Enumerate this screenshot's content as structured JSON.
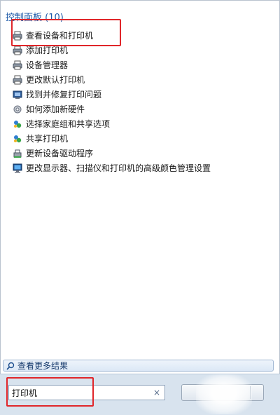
{
  "header": {
    "title": "控制面板 (10)"
  },
  "items": [
    {
      "label": "查看设备和打印机",
      "icon": "printer-icon"
    },
    {
      "label": "添加打印机",
      "icon": "printer-icon"
    },
    {
      "label": "设备管理器",
      "icon": "printer-icon"
    },
    {
      "label": "更改默认打印机",
      "icon": "printer-icon"
    },
    {
      "label": "找到并修复打印问题",
      "icon": "troubleshoot-icon"
    },
    {
      "label": "如何添加新硬件",
      "icon": "gear-icon"
    },
    {
      "label": "选择家庭组和共享选项",
      "icon": "homegroup-icon"
    },
    {
      "label": "共享打印机",
      "icon": "homegroup-icon"
    },
    {
      "label": "更新设备驱动程序",
      "icon": "device-driver-icon"
    },
    {
      "label": "更改显示器、扫描仪和打印机的高级颜色管理设置",
      "icon": "monitor-icon"
    }
  ],
  "more_results": {
    "label": "查看更多结果"
  },
  "search": {
    "value": "打印机",
    "clear_glyph": "×"
  },
  "colors": {
    "accent": "#1e5aa8",
    "highlight": "#e0262a"
  }
}
